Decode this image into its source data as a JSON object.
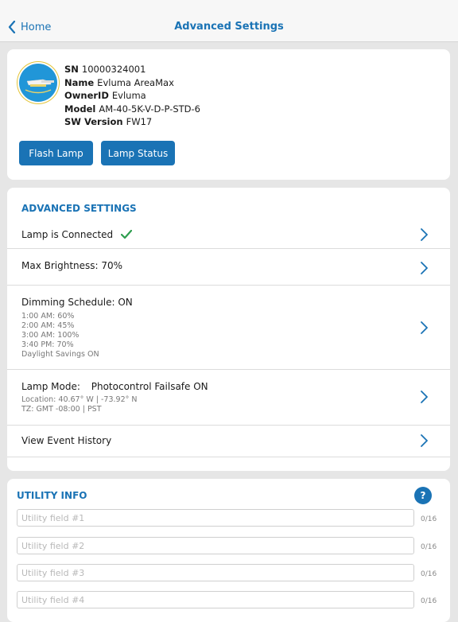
{
  "nav": {
    "back_label": "Home",
    "title": "Advanced Settings"
  },
  "device": {
    "sn_label": "SN",
    "sn": "10000324001",
    "name_label": "Name",
    "name": "Evluma AreaMax",
    "owner_label": "OwnerID",
    "owner": "Evluma",
    "model_label": "Model",
    "model": "AM-40-5K-V-D-P-STD-6",
    "sw_label": "SW Version",
    "sw": "FW17",
    "flash_button": "Flash Lamp",
    "status_button": "Lamp Status"
  },
  "advanced": {
    "header": "ADVANCED SETTINGS",
    "connected": "Lamp is Connected",
    "brightness": "Max Brightness:  70%",
    "dimming": "Dimming Schedule:  ON",
    "dimming_lines": [
      "1:00 AM: 60%",
      "2:00 AM: 45%",
      "3:00 AM: 100%",
      "3:40 PM: 70%",
      "Daylight Savings ON"
    ],
    "lamp_mode_label": "Lamp Mode:",
    "lamp_mode_value": "Photocontrol Failsafe ON",
    "location": "Location: 40.67° W | -73.92° N",
    "tz": "TZ: GMT -08:00 | PST",
    "event_history": "View Event History"
  },
  "utility": {
    "header": "UTILITY INFO",
    "help": "?",
    "fields": [
      {
        "placeholder": "Utility field #1",
        "value": "",
        "count": "0/16"
      },
      {
        "placeholder": "Utility field #2",
        "value": "",
        "count": "0/16"
      },
      {
        "placeholder": "Utility field #3",
        "value": "",
        "count": "0/16"
      },
      {
        "placeholder": "Utility field #4",
        "value": "",
        "count": "0/16"
      }
    ]
  },
  "colors": {
    "accent": "#1a73b5",
    "check": "#2e9e4f",
    "background": "#e6e6e6"
  },
  "icons": {
    "back": "chevron-left-icon",
    "row": "chevron-right-icon",
    "connected": "checkmark-icon"
  }
}
